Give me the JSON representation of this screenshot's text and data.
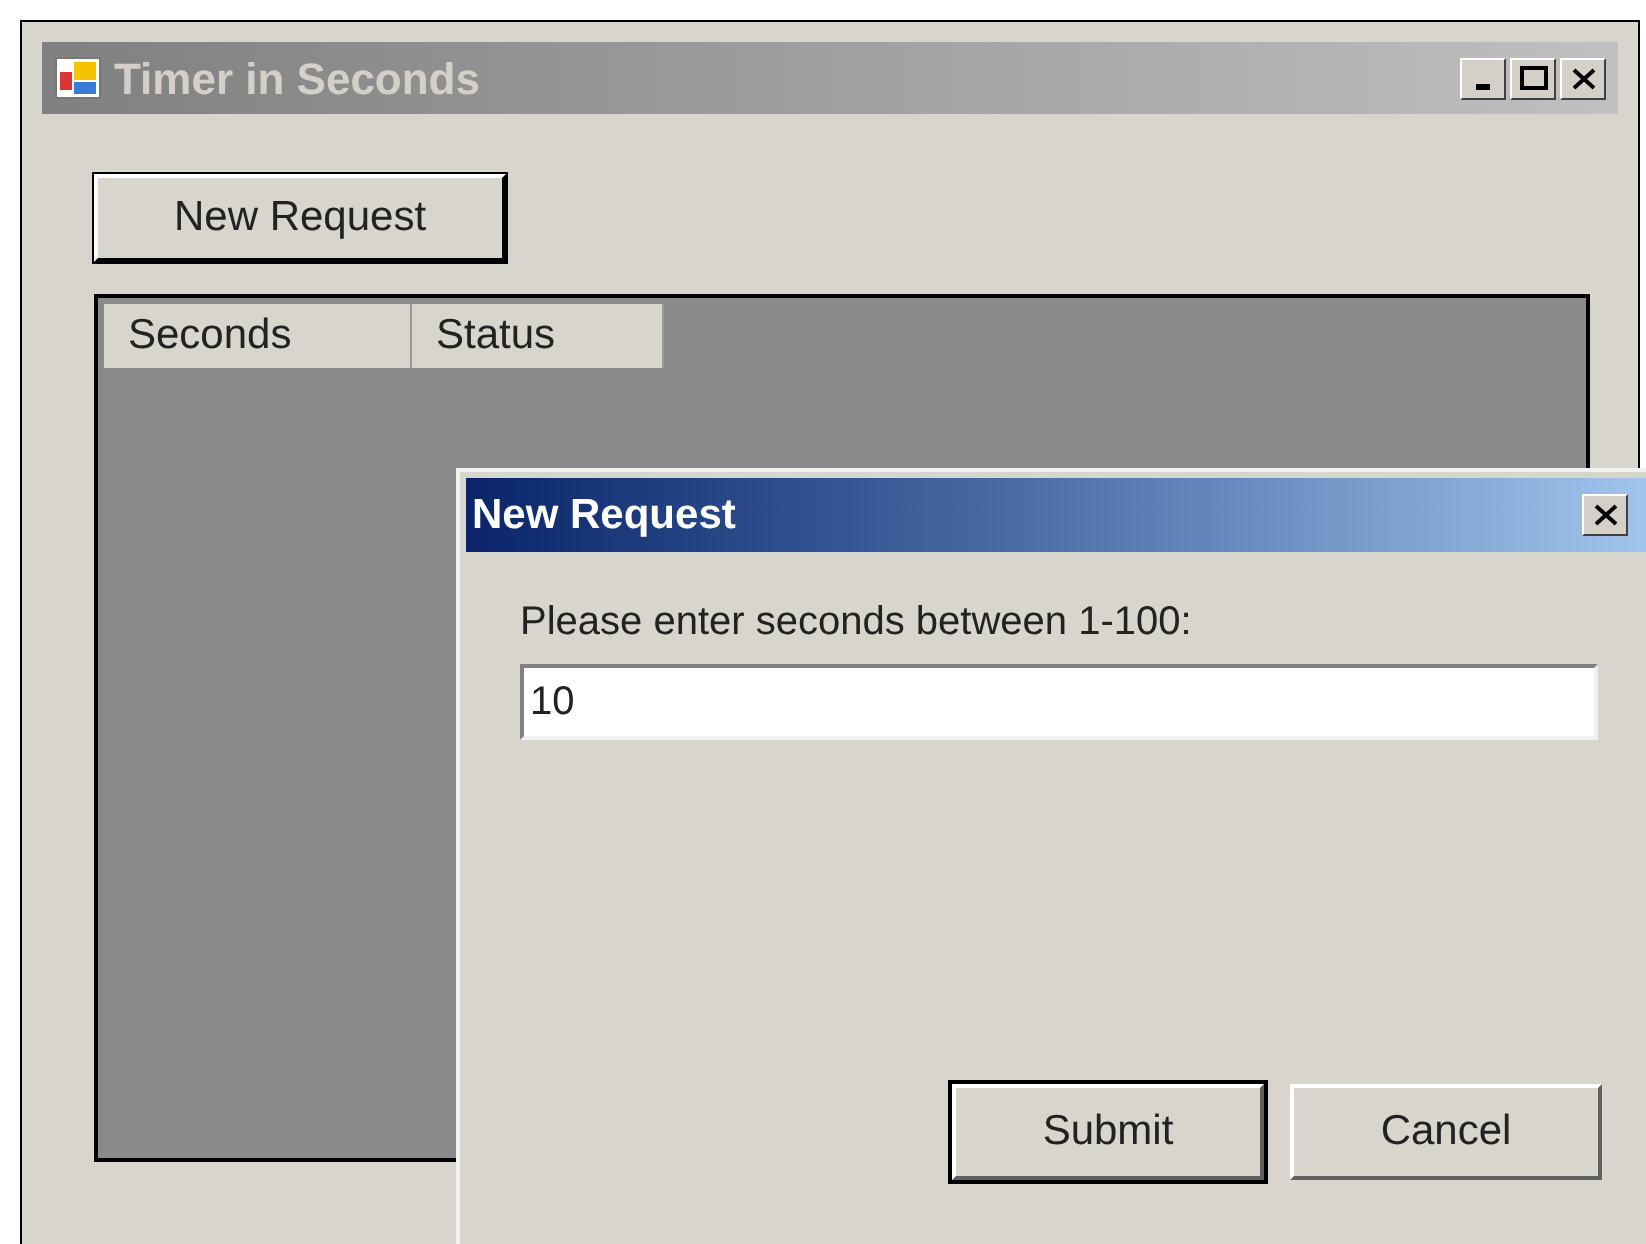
{
  "main_window": {
    "title": "Timer in Seconds",
    "active": false,
    "new_request_button": "New Request",
    "list": {
      "columns": [
        "Seconds",
        "Status"
      ]
    }
  },
  "dialog": {
    "title": "New Request",
    "active": true,
    "prompt": "Please enter seconds between 1-100:",
    "seconds_field": {
      "value": "10"
    },
    "buttons": [
      {
        "label": "Submit",
        "default": true
      },
      {
        "label": "Cancel",
        "default": false
      }
    ]
  }
}
